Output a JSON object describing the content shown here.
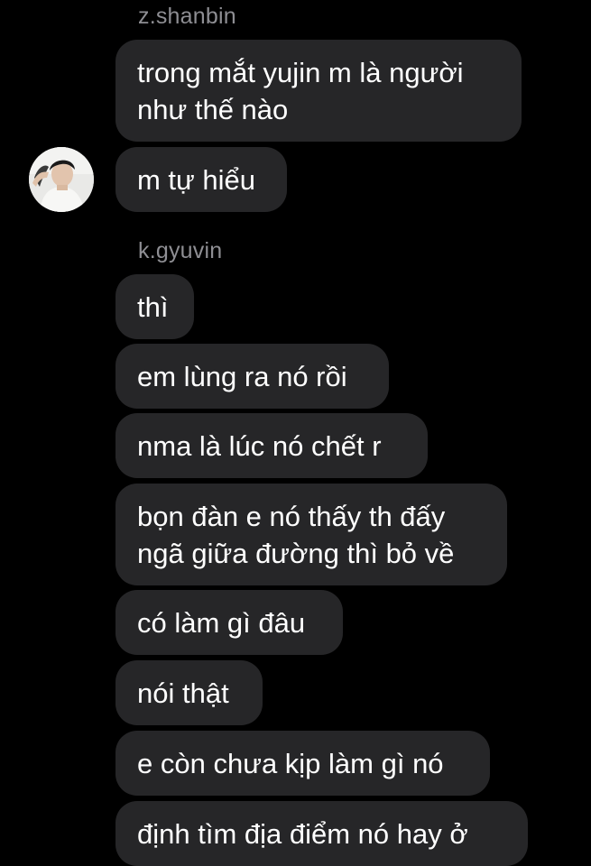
{
  "thread": {
    "groups": [
      {
        "sender": "z.shanbin",
        "messages": [
          "trong mắt yujin m là người\nnhư thế nào",
          "m tự hiểu"
        ]
      },
      {
        "sender": "k.gyuvin",
        "messages": [
          "thì",
          "em lùng ra nó rồi",
          "nma là lúc nó chết r",
          "bọn đàn e nó thấy th đấy\nngã giữa đường thì bỏ về",
          "có làm gì đâu",
          "nói thật",
          "e còn chưa kịp làm gì nó",
          "định tìm địa điểm nó hay ở"
        ]
      }
    ]
  },
  "avatar": {
    "icon": "user-avatar-photo"
  },
  "colors": {
    "background": "#000000",
    "bubble": "#262628",
    "sender": "#8e8e93",
    "text": "#ffffff"
  }
}
